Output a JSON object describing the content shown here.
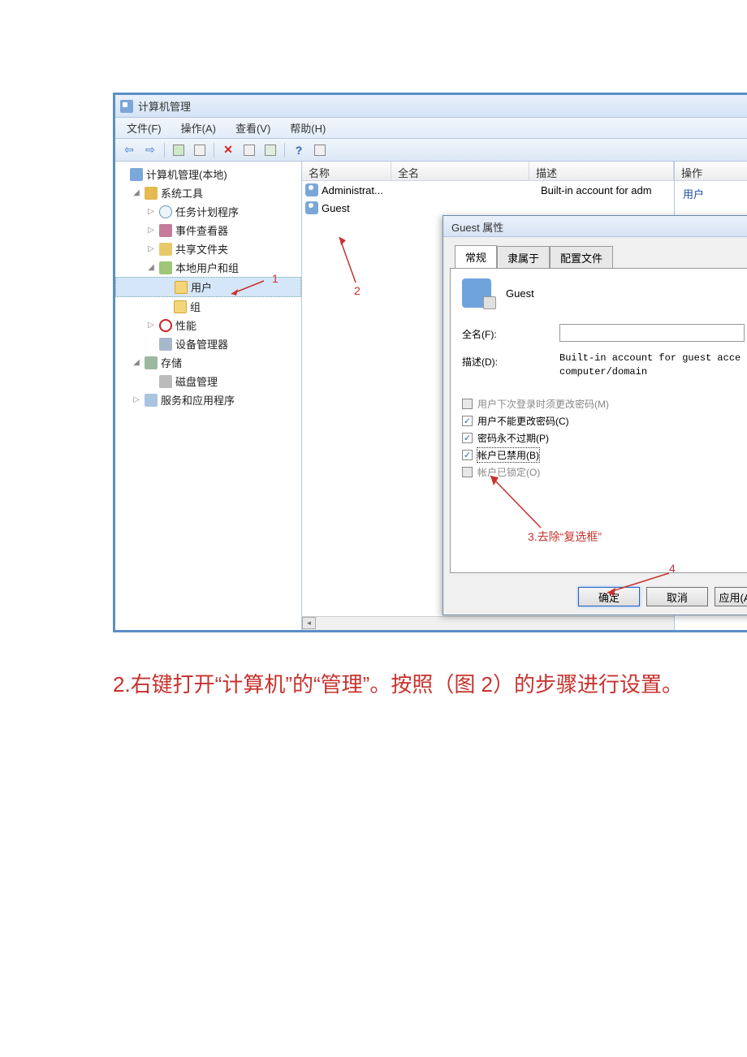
{
  "window": {
    "title": "计算机管理",
    "menus": [
      "文件(F)",
      "操作(A)",
      "查看(V)",
      "帮助(H)"
    ]
  },
  "tree": {
    "root": "计算机管理(本地)",
    "systools": "系统工具",
    "tasksched": "任务计划程序",
    "eventvwr": "事件查看器",
    "shared": "共享文件夹",
    "localusers": "本地用户和组",
    "users": "用户",
    "groups": "组",
    "perf": "性能",
    "devmgr": "设备管理器",
    "storage": "存储",
    "diskmgmt": "磁盘管理",
    "services": "服务和应用程序"
  },
  "list": {
    "columns": {
      "name": "名称",
      "fullname": "全名",
      "desc": "描述"
    },
    "rows": [
      {
        "name": "Administrat...",
        "full": "",
        "desc": "Built-in account for adm"
      },
      {
        "name": "Guest",
        "full": "",
        "desc": ""
      }
    ]
  },
  "actions": {
    "header": "操作",
    "item": "用户"
  },
  "dialog": {
    "title": "Guest 属性",
    "tabs": [
      "常规",
      "隶属于",
      "配置文件"
    ],
    "username": "Guest",
    "fullname_label": "全名(F):",
    "fullname_value": "",
    "desc_label": "描述(D):",
    "desc_value": "Built-in account for guest acce computer/domain",
    "checkboxes": [
      {
        "label": "用户下次登录时须更改密码(M)",
        "checked": false,
        "disabled": true
      },
      {
        "label": "用户不能更改密码(C)",
        "checked": true,
        "disabled": false
      },
      {
        "label": "密码永不过期(P)",
        "checked": true,
        "disabled": false
      },
      {
        "label": "帐户已禁用(B)",
        "checked": true,
        "disabled": false,
        "focused": true
      },
      {
        "label": "帐户已锁定(O)",
        "checked": false,
        "disabled": true
      }
    ],
    "buttons": {
      "ok": "确定",
      "cancel": "取消",
      "apply": "应用(A"
    }
  },
  "annotations": {
    "a1": "1",
    "a2": "2",
    "a3": "3.去除“复选框”",
    "a4": "4"
  },
  "caption": "2.右键打开“计算机”的“管理”。按照（图 2）的步骤进行设置。"
}
